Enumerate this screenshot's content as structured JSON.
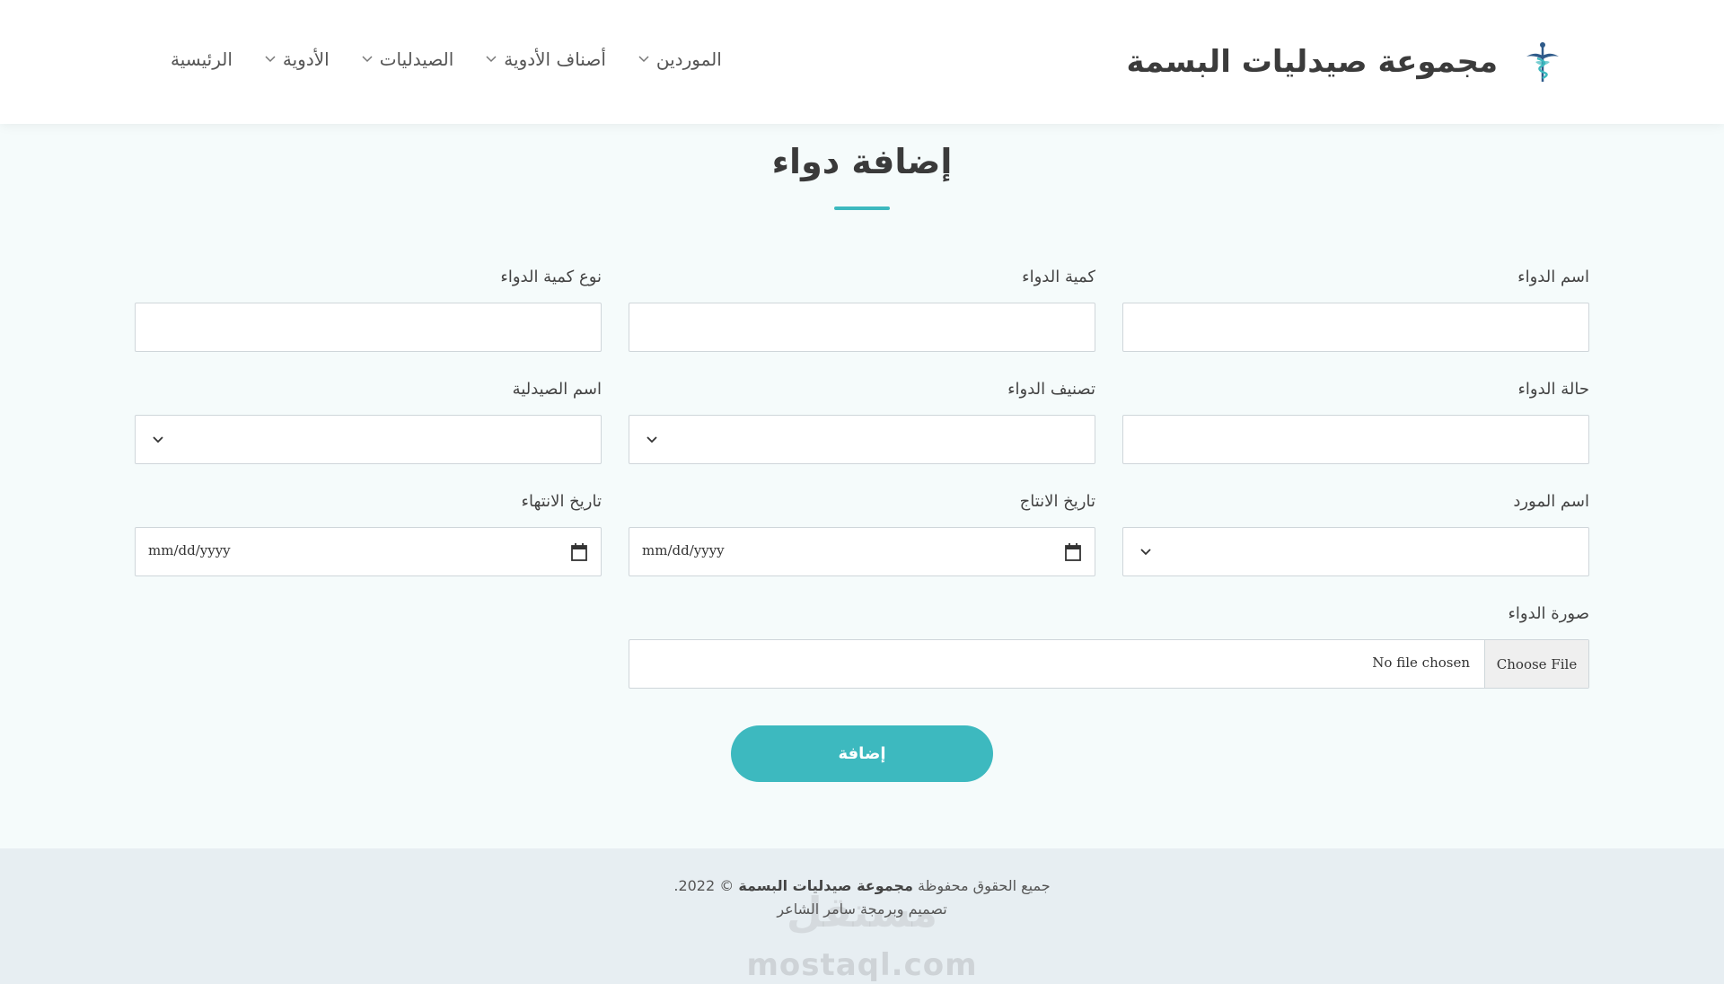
{
  "header": {
    "brand_name": "مجموعة صيدليات البسمة",
    "logo_icon": "caduceus-icon",
    "nav": [
      {
        "label": "الرئيسية",
        "dropdown": false
      },
      {
        "label": "الأدوية",
        "dropdown": true
      },
      {
        "label": "الصيدليات",
        "dropdown": true
      },
      {
        "label": "أصناف الأدوية",
        "dropdown": true
      },
      {
        "label": "الموردين",
        "dropdown": true
      }
    ]
  },
  "page": {
    "title": "إضافة دواء",
    "accent_color": "#3db9bf"
  },
  "form": {
    "drug_name": {
      "label": "اسم الدواء",
      "value": ""
    },
    "drug_quantity": {
      "label": "كمية الدواء",
      "value": ""
    },
    "quantity_type": {
      "label": "نوع كمية الدواء",
      "value": ""
    },
    "drug_status": {
      "label": "حالة الدواء",
      "value": ""
    },
    "drug_category": {
      "label": "تصنيف الدواء",
      "value": ""
    },
    "pharmacy_name": {
      "label": "اسم الصيدلية",
      "value": ""
    },
    "supplier_name": {
      "label": "اسم المورد",
      "value": ""
    },
    "production_date": {
      "label": "تاريخ الانتاج",
      "placeholder": "mm/dd/yyyy"
    },
    "expiry_date": {
      "label": "تاريخ الانتهاء",
      "placeholder": "mm/dd/yyyy"
    },
    "drug_image": {
      "label": "صورة الدواء",
      "button": "Choose File",
      "status": "No file chosen"
    },
    "submit_label": "إضافة"
  },
  "footer": {
    "rights_prefix": "جميع الحقوق محفوظة",
    "rights_brand": "مجموعة صيدليات البسمة",
    "rights_suffix": "© 2022.",
    "credit": "تصميم وبرمجة سامر الشاعر",
    "watermark_ar": "مستقل",
    "watermark": "mostaql.com"
  }
}
